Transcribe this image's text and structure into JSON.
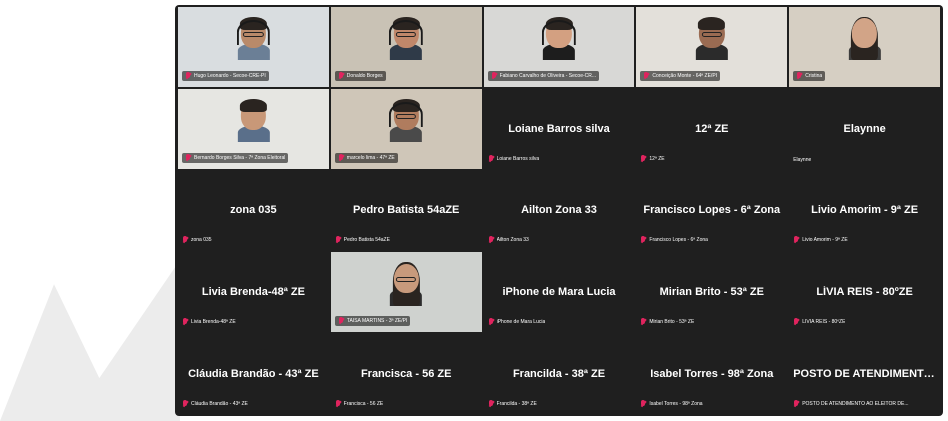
{
  "tiles": [
    {
      "name": "Hugo Leonardo - Secoe-CRE-PI",
      "kind": "video",
      "bg": "#d9dde0",
      "skin": "#b98a6a",
      "shirt": "#6b7f96",
      "hair": "short",
      "glasses": true,
      "headset": true
    },
    {
      "name": "Donaldo Borges",
      "kind": "video",
      "bg": "#c9c2b5",
      "skin": "#c0876a",
      "shirt": "#2f3a48",
      "hair": "short",
      "glasses": true,
      "headset": true
    },
    {
      "name": "Fabiano Carvalho de Oliveira - Secoe-CR...",
      "kind": "video",
      "bg": "#d8d8d6",
      "skin": "#d3a081",
      "shirt": "#1d1d1d",
      "hair": "short",
      "glasses": false,
      "headset": true
    },
    {
      "name": "Conceição Monte - 64ª ZE/PI",
      "kind": "video",
      "bg": "#e3e0da",
      "skin": "#9a6b52",
      "shirt": "#2b2b2b",
      "hair": "short",
      "glasses": true,
      "headset": false
    },
    {
      "name": "Cristina",
      "kind": "video",
      "bg": "#d6cfc3",
      "skin": "#d2a487",
      "shirt": "#3d3d3d",
      "hair": "long",
      "glasses": false,
      "headset": false
    },
    {
      "name": "Bernardo Borges Silva - 7ª Zona Eleitoral",
      "kind": "video",
      "bg": "#e6e6e2",
      "skin": "#c89878",
      "shirt": "#5a6f8a",
      "hair": "short",
      "glasses": false,
      "headset": false
    },
    {
      "name": "marcelo lima - 47ª ZE",
      "kind": "video",
      "bg": "#cfc6b8",
      "skin": "#b07c5e",
      "shirt": "#4a4a4a",
      "hair": "short",
      "glasses": true,
      "headset": true
    },
    {
      "name": "Loiane Barros silva",
      "kind": "name",
      "label": "Loiane Barros silva",
      "muted": true
    },
    {
      "name": "12ª ZE",
      "kind": "name",
      "label": "12ª ZE",
      "muted": true
    },
    {
      "name": "Elaynne",
      "kind": "name",
      "label": "Elaynne",
      "muted": false
    },
    {
      "name": "zona 035",
      "kind": "name",
      "label": "zona 035",
      "muted": true
    },
    {
      "name": "Pedro Batista 54aZE",
      "kind": "name",
      "label": "Pedro Batista 54aZE",
      "muted": true
    },
    {
      "name": "Ailton Zona 33",
      "kind": "name",
      "label": "Ailton Zona 33",
      "muted": true
    },
    {
      "name": "Francisco Lopes - 6ª Zona",
      "kind": "name",
      "label": "Francisco Lopes - 6ª Zona",
      "muted": true
    },
    {
      "name": "Livio Amorim - 9ª ZE",
      "kind": "name",
      "label": "Livio Amorim - 9ª ZE",
      "muted": true
    },
    {
      "name": "Livia Brenda-48ª ZE",
      "kind": "name",
      "label": "Livia Brenda-48ª ZE",
      "muted": true
    },
    {
      "name": "TAISA MARTINS - 3ª ZE/PI",
      "kind": "video",
      "bg": "#cfd2cf",
      "skin": "#c89a7c",
      "shirt": "#2c2c2c",
      "hair": "long",
      "glasses": true,
      "headset": false
    },
    {
      "name": "iPhone de Mara Lucia",
      "kind": "name",
      "label": "iPhone de Mara Lucia",
      "muted": true
    },
    {
      "name": "Mirian Brito - 53ª ZE",
      "kind": "name",
      "label": "Mirian Brito - 53ª ZE",
      "muted": true
    },
    {
      "name": "LÍVIA REIS - 80ºZE",
      "kind": "name",
      "label": "LÍVIA REIS - 80ºZE",
      "muted": true
    },
    {
      "name": "Cláudia Brandão - 43ª ZE",
      "kind": "name",
      "label": "Cláudia Brandão - 43ª ZE",
      "muted": true
    },
    {
      "name": "Francisca - 56 ZE",
      "kind": "name",
      "label": "Francisca - 56 ZE",
      "muted": true
    },
    {
      "name": "Francilda - 38ª ZE",
      "kind": "name",
      "label": "Francilda - 38ª ZE",
      "muted": true
    },
    {
      "name": "Isabel Torres - 98ª Zona",
      "kind": "name",
      "label": "Isabel Torres - 98ª Zona",
      "muted": true
    },
    {
      "name": "POSTO DE ATENDIMENTO A...",
      "kind": "name",
      "label": "POSTO DE ATENDIMENTO AO ELEITOR DE...",
      "muted": true
    }
  ]
}
